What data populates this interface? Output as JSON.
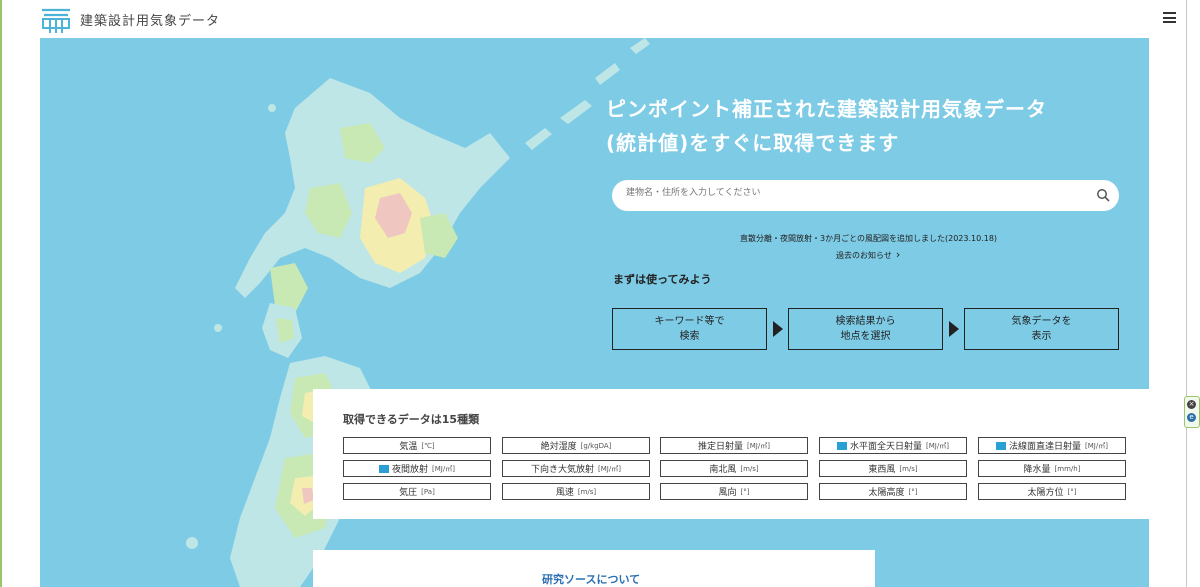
{
  "header": {
    "logo_text": "建築設計用気象データ",
    "menu_icon": "hamburger-icon"
  },
  "hero": {
    "headline_line1": "ピンポイント補正された建築設計用気象データ",
    "headline_line2": "(統計値)をすぐに取得できます",
    "search": {
      "placeholder": "建物名・住所を入力してください",
      "icon": "search-icon"
    },
    "news_text": "直散分離・夜間放射・3か月ごとの風配図を追加しました(2023.10.18)",
    "news_link": "過去のお知らせ",
    "try_title": "まずは使ってみよう",
    "steps": [
      {
        "line1": "キーワード等で",
        "line2": "検索"
      },
      {
        "line1": "検索結果から",
        "line2": "地点を選択"
      },
      {
        "line1": "気象データを",
        "line2": "表示"
      }
    ]
  },
  "data_types": {
    "title": "取得できるデータは15種類",
    "items": [
      {
        "label": "気温",
        "unit": "[℃]",
        "new": false
      },
      {
        "label": "絶対湿度",
        "unit": "[g/kgDA]",
        "new": false
      },
      {
        "label": "推定日射量",
        "unit": "[MJ/㎡]",
        "new": false
      },
      {
        "label": "水平面全天日射量",
        "unit": "[MJ/㎡]",
        "new": true
      },
      {
        "label": "法線面直達日射量",
        "unit": "[MJ/㎡]",
        "new": true
      },
      {
        "label": "夜間放射",
        "unit": "[MJ/㎡]",
        "new": true
      },
      {
        "label": "下向き大気放射",
        "unit": "[MJ/㎡]",
        "new": false
      },
      {
        "label": "南北風",
        "unit": "[m/s]",
        "new": false
      },
      {
        "label": "東西風",
        "unit": "[m/s]",
        "new": false
      },
      {
        "label": "降水量",
        "unit": "[mm/h]",
        "new": false
      },
      {
        "label": "気圧",
        "unit": "[Pa]",
        "new": false
      },
      {
        "label": "風速",
        "unit": "[m/s]",
        "new": false
      },
      {
        "label": "風向",
        "unit": "[°]",
        "new": false
      },
      {
        "label": "太陽高度",
        "unit": "[°]",
        "new": false
      },
      {
        "label": "太陽方位",
        "unit": "[°]",
        "new": false
      }
    ]
  },
  "research": {
    "title": "研究ソースについて"
  },
  "colors": {
    "sea": "#7ecbe6",
    "land_base": "#bfe6e6",
    "land_green": "#c8e8b4",
    "land_yellow": "#f3edb0",
    "land_pink": "#efc6c0",
    "accent_blue": "#2b6fb1"
  }
}
